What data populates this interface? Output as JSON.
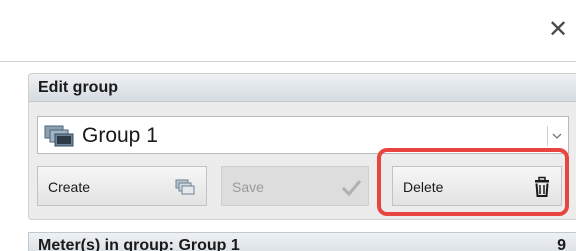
{
  "window": {
    "close_glyph": "✕"
  },
  "edit_group": {
    "title": "Edit group",
    "selected_group": "Group 1",
    "group_icon": "group-stack-icon",
    "dropdown_icon": "chevron-down-icon"
  },
  "buttons": {
    "create": {
      "label": "Create",
      "icon": "group-add-icon"
    },
    "save": {
      "label": "Save",
      "icon": "checkmark-icon",
      "disabled": true
    },
    "delete": {
      "label": "Delete",
      "icon": "trash-icon"
    }
  },
  "meters": {
    "label": "Meter(s) in group: Group 1",
    "count": "9"
  },
  "colors": {
    "highlight": "#e8453f",
    "panel_bg": "#ececec"
  }
}
